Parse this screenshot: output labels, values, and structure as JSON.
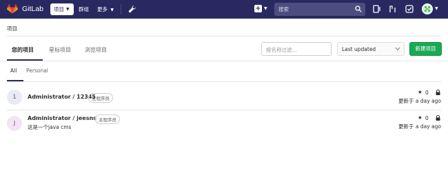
{
  "nav": {
    "brand": "GitLab",
    "projects": "项目",
    "groups": "群组",
    "more": "更多",
    "search_placeholder": "搜索"
  },
  "breadcrumb": "项目",
  "tabs": [
    {
      "label": "您的项目",
      "active": true
    },
    {
      "label": "星标项目",
      "active": false
    },
    {
      "label": "浏览项目",
      "active": false
    }
  ],
  "filter_placeholder": "按名称过滤...",
  "sort_selected": "Last updated",
  "new_project_label": "新建项目",
  "subtabs": [
    {
      "label": "All",
      "active": true
    },
    {
      "label": "Personal",
      "active": false
    }
  ],
  "projects": [
    {
      "avatar_letter": "1",
      "avatar_color": "#e8eaf6",
      "name": "Administrator / 12345",
      "role": "主程序员",
      "description": "",
      "stars": "0",
      "updated": "更新于 a day ago"
    },
    {
      "avatar_letter": "J",
      "avatar_color": "#f3e5f5",
      "name": "Administrator / jeesns",
      "role": "主程序员",
      "description": "这是一个java cms",
      "stars": "0",
      "updated": "更新于 a day ago"
    }
  ],
  "colors": {
    "navbar": "#292961",
    "accent_green": "#1aaa55"
  }
}
